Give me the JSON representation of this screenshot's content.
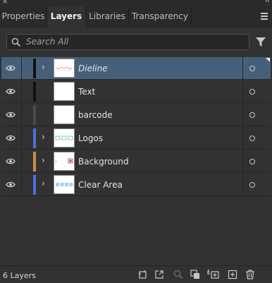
{
  "window": {
    "close_glyph": "×",
    "collapse_glyph": "‹‹"
  },
  "tabs": [
    {
      "label": "Properties",
      "active": false
    },
    {
      "label": "Layers",
      "active": true
    },
    {
      "label": "Libraries",
      "active": false
    },
    {
      "label": "Transparency",
      "active": false
    }
  ],
  "panel_menu_icon": "hamburger-menu-icon",
  "search": {
    "placeholder": "Search All",
    "icon": "search-icon"
  },
  "filter_icon": "filter-icon",
  "layers": [
    {
      "name": "Dieline",
      "color": "#111111",
      "expandable": true,
      "selected": true,
      "italic": true,
      "thumb": "dieline"
    },
    {
      "name": "Text",
      "color": "#111111",
      "expandable": false,
      "selected": false,
      "italic": false,
      "thumb": "blank"
    },
    {
      "name": "barcode",
      "color": "#4a4a4a",
      "expandable": false,
      "selected": false,
      "italic": false,
      "thumb": "blank"
    },
    {
      "name": "Logos",
      "color": "#4a72d8",
      "expandable": true,
      "selected": false,
      "italic": false,
      "thumb": "logos"
    },
    {
      "name": "Background",
      "color": "#c98a4e",
      "expandable": true,
      "selected": false,
      "italic": false,
      "thumb": "background"
    },
    {
      "name": "Clear Area",
      "color": "#4a72d8",
      "expandable": true,
      "selected": false,
      "italic": false,
      "thumb": "cleararea"
    }
  ],
  "footer": {
    "count": "6 Layers",
    "icons": [
      "collect-for-export-icon",
      "export-icon",
      "locate-object-icon",
      "make-clipping-mask-icon",
      "create-sublayer-icon",
      "create-new-layer-icon",
      "delete-icon"
    ]
  }
}
